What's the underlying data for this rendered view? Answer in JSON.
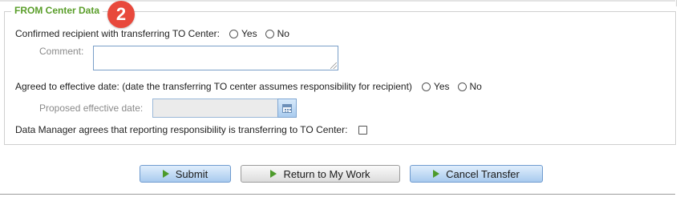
{
  "section": {
    "legend": "FROM Center Data",
    "badge": "2"
  },
  "confirm": {
    "label": "Confirmed recipient with transferring TO Center:",
    "yes": "Yes",
    "no": "No"
  },
  "comment": {
    "label": "Comment:",
    "value": ""
  },
  "agree": {
    "label": "Agreed to effective date: (date the transferring TO center assumes responsibility for recipient)",
    "yes": "Yes",
    "no": "No"
  },
  "proposed": {
    "label": "Proposed effective date:",
    "value": ""
  },
  "data_manager": {
    "label": "Data Manager agrees that reporting responsibility is transferring to TO Center:"
  },
  "buttons": {
    "submit": "Submit",
    "return": "Return to My Work",
    "cancel": "Cancel Transfer"
  },
  "colors": {
    "legend": "#5a9e2a",
    "badge": "#e8493c",
    "button_arrow": "#4c9a2a"
  },
  "icons": {
    "button_arrow": "play-arrow-icon",
    "calendar": "calendar-icon"
  }
}
